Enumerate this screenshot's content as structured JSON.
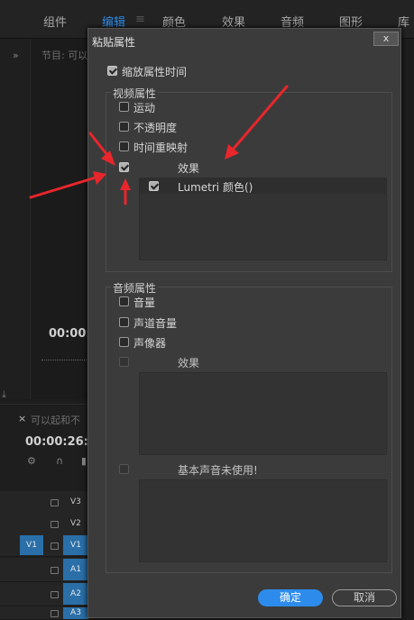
{
  "menu": {
    "items": [
      "组件",
      "编辑",
      "颜色",
      "效果",
      "音频",
      "图形",
      "库"
    ],
    "active_index": 1
  },
  "background": {
    "program_label": "节目: 可以",
    "program_timecode": "00:00:",
    "timeline_tab": "可以起和不",
    "timeline_timecode": "00:00:26:",
    "tracks": [
      "V3",
      "V2",
      "V1",
      "A1",
      "A2",
      "A3"
    ],
    "source_v1": "V1"
  },
  "dialog": {
    "title": "粘贴属性",
    "close_label": "x",
    "scale_time": {
      "label": "缩放属性时间",
      "checked": true
    },
    "video": {
      "title": "视频属性",
      "motion": {
        "label": "运动",
        "checked": false
      },
      "opacity": {
        "label": "不透明度",
        "checked": false
      },
      "time_remap": {
        "label": "时间重映射",
        "checked": false
      },
      "effects": {
        "label": "效果",
        "checked": true
      },
      "effect_items": [
        {
          "label": "Lumetri 颜色()",
          "checked": true
        }
      ]
    },
    "audio": {
      "title": "音频属性",
      "volume": {
        "label": "音量",
        "checked": false
      },
      "channel_volume": {
        "label": "声道音量",
        "checked": false
      },
      "panner": {
        "label": "声像器",
        "checked": false
      },
      "effects": {
        "label": "效果",
        "checked": false
      },
      "essential_sound": {
        "label": "基本声音未使用!",
        "checked": false
      }
    },
    "ok_label": "确定",
    "cancel_label": "取消"
  },
  "colors": {
    "accent": "#2d8ceb",
    "annotation_arrow": "#e8262b"
  }
}
